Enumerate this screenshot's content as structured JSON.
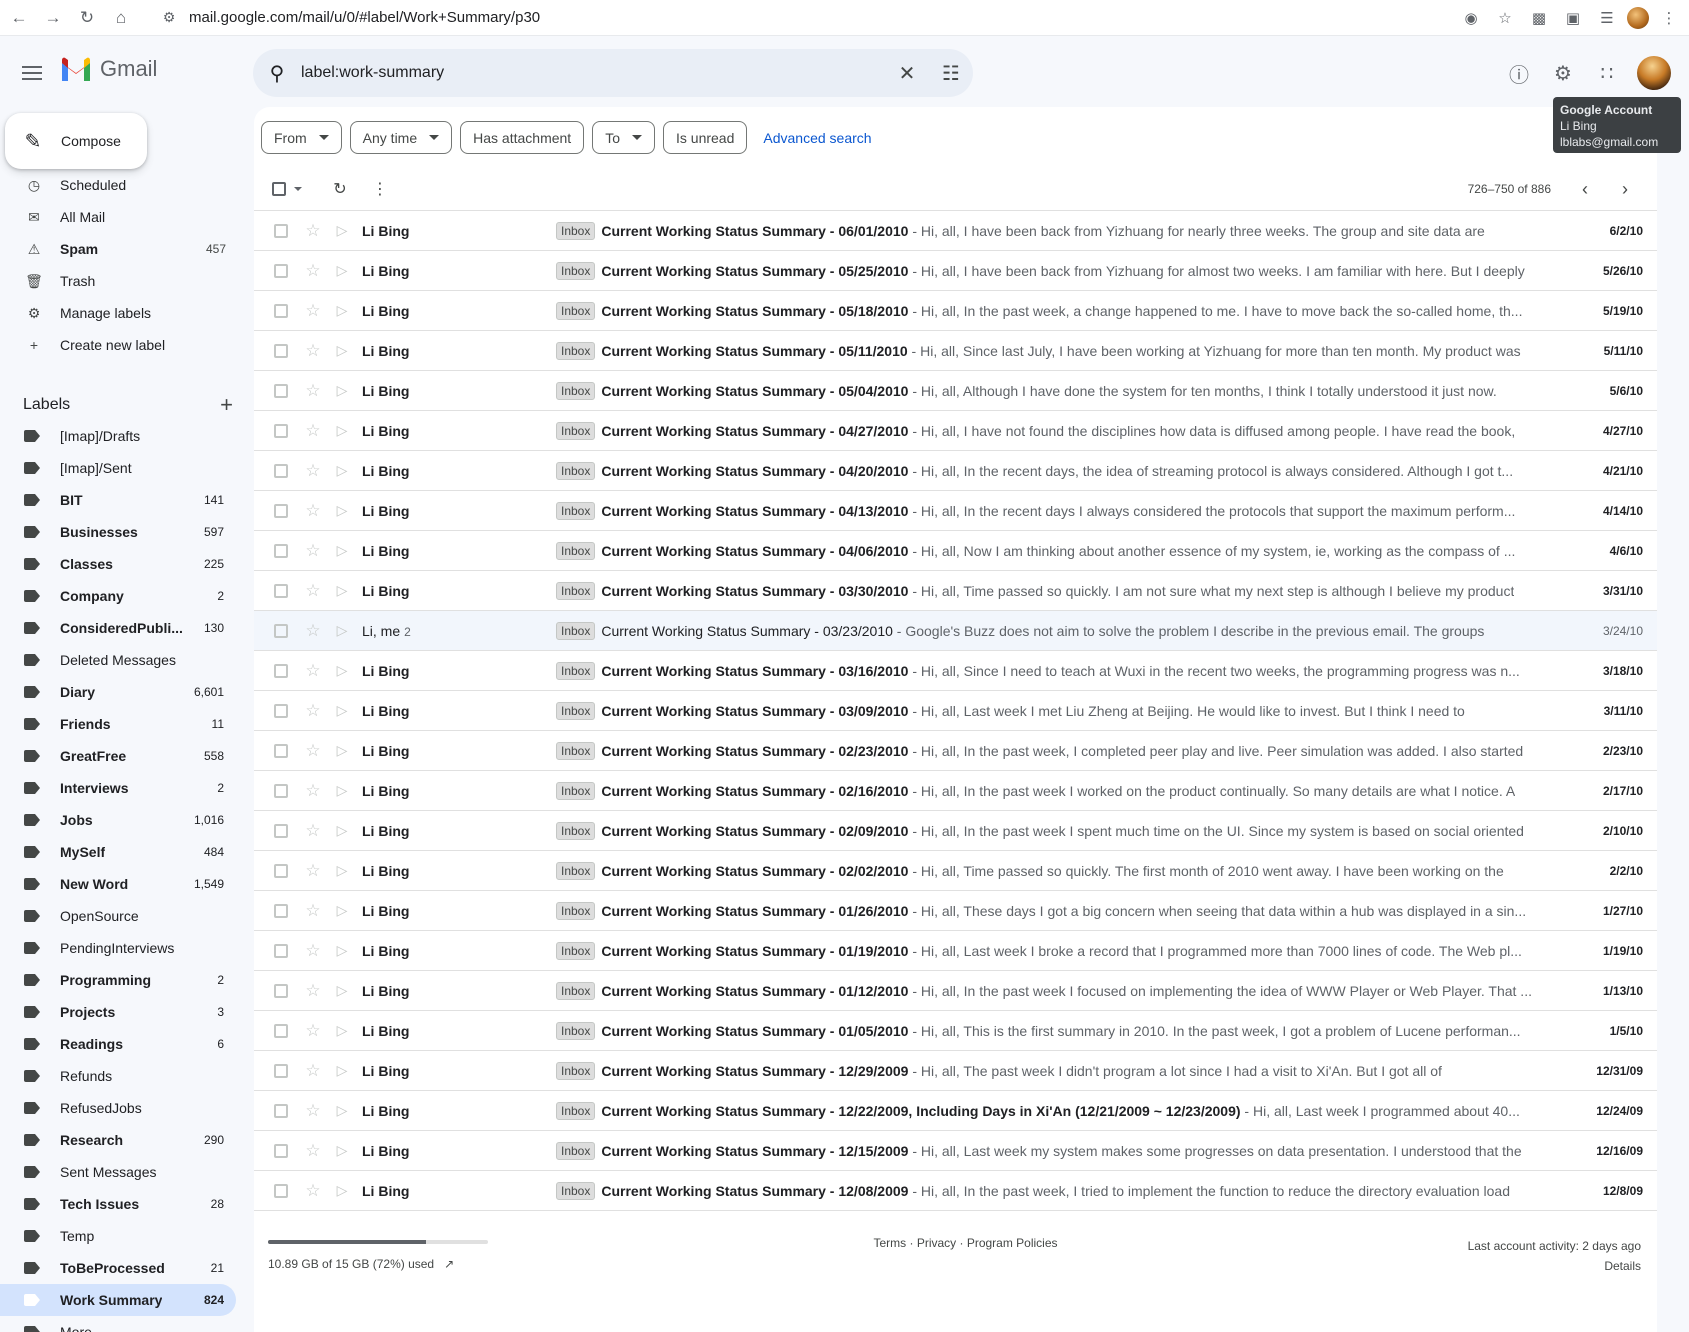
{
  "browser": {
    "url": "mail.google.com/mail/u/0/#label/Work+Summary/p30"
  },
  "header": {
    "app_name": "Gmail",
    "search_value": "label:work-summary"
  },
  "tooltip": {
    "title": "Google Account",
    "name": "Li Bing",
    "email": "lblabs@gmail.com"
  },
  "sidebar": {
    "compose_label": "Compose",
    "nav": [
      {
        "label": "Scheduled",
        "count": "",
        "icon": "scheduled-icon",
        "bold": false
      },
      {
        "label": "All Mail",
        "count": "",
        "icon": "all-mail-icon",
        "bold": false
      },
      {
        "label": "Spam",
        "count": "457",
        "icon": "spam-icon",
        "bold": true
      },
      {
        "label": "Trash",
        "count": "",
        "icon": "trash-icon",
        "bold": false
      },
      {
        "label": "Manage labels",
        "count": "",
        "icon": "gear-icon",
        "bold": false
      },
      {
        "label": "Create new label",
        "count": "",
        "icon": "plus-icon",
        "bold": false
      }
    ],
    "labels_heading": "Labels",
    "labels": [
      {
        "label": "[Imap]/Drafts",
        "count": "",
        "bold": false
      },
      {
        "label": "[Imap]/Sent",
        "count": "",
        "bold": false
      },
      {
        "label": "BIT",
        "count": "141",
        "bold": true
      },
      {
        "label": "Businesses",
        "count": "597",
        "bold": true
      },
      {
        "label": "Classes",
        "count": "225",
        "bold": true
      },
      {
        "label": "Company",
        "count": "2",
        "bold": true
      },
      {
        "label": "ConsideredPubli...",
        "count": "130",
        "bold": true
      },
      {
        "label": "Deleted Messages",
        "count": "",
        "bold": false
      },
      {
        "label": "Diary",
        "count": "6,601",
        "bold": true
      },
      {
        "label": "Friends",
        "count": "11",
        "bold": true
      },
      {
        "label": "GreatFree",
        "count": "558",
        "bold": true
      },
      {
        "label": "Interviews",
        "count": "2",
        "bold": true
      },
      {
        "label": "Jobs",
        "count": "1,016",
        "bold": true
      },
      {
        "label": "MySelf",
        "count": "484",
        "bold": true
      },
      {
        "label": "New Word",
        "count": "1,549",
        "bold": true
      },
      {
        "label": "OpenSource",
        "count": "",
        "bold": false
      },
      {
        "label": "PendingInterviews",
        "count": "",
        "bold": false
      },
      {
        "label": "Programming",
        "count": "2",
        "bold": true
      },
      {
        "label": "Projects",
        "count": "3",
        "bold": true
      },
      {
        "label": "Readings",
        "count": "6",
        "bold": true
      },
      {
        "label": "Refunds",
        "count": "",
        "bold": false
      },
      {
        "label": "RefusedJobs",
        "count": "",
        "bold": false
      },
      {
        "label": "Research",
        "count": "290",
        "bold": true
      },
      {
        "label": "Sent Messages",
        "count": "",
        "bold": false
      },
      {
        "label": "Tech Issues",
        "count": "28",
        "bold": true
      },
      {
        "label": "Temp",
        "count": "",
        "bold": false
      },
      {
        "label": "ToBeProcessed",
        "count": "21",
        "bold": true
      },
      {
        "label": "Work Summary",
        "count": "824",
        "bold": true,
        "active": true
      },
      {
        "label": "More",
        "count": "",
        "bold": false
      }
    ]
  },
  "filters": {
    "chips": [
      {
        "label": "From",
        "dropdown": true
      },
      {
        "label": "Any time",
        "dropdown": true
      },
      {
        "label": "Has attachment",
        "dropdown": false
      },
      {
        "label": "To",
        "dropdown": true
      },
      {
        "label": "Is unread",
        "dropdown": false
      }
    ],
    "advanced_search": "Advanced search"
  },
  "pager": {
    "text": "726–750 of 886"
  },
  "emails": [
    {
      "sender": "Li Bing",
      "count": "",
      "badge": "Inbox",
      "subject": "Current Working Status Summary - 06/01/2010",
      "snippet": " - Hi, all, I have been back from Yizhuang for nearly three weeks. The group and site data are",
      "date": "6/2/10",
      "read": false
    },
    {
      "sender": "Li Bing",
      "count": "",
      "badge": "Inbox",
      "subject": "Current Working Status Summary - 05/25/2010",
      "snippet": " - Hi, all, I have been back from Yizhuang for almost two weeks. I am familiar with here. But I deeply",
      "date": "5/26/10",
      "read": false
    },
    {
      "sender": "Li Bing",
      "count": "",
      "badge": "Inbox",
      "subject": "Current Working Status Summary - 05/18/2010",
      "snippet": " - Hi, all, In the past week, a change happened to me. I have to move back the so-called home, th...",
      "date": "5/19/10",
      "read": false
    },
    {
      "sender": "Li Bing",
      "count": "",
      "badge": "Inbox",
      "subject": "Current Working Status Summary - 05/11/2010",
      "snippet": " - Hi, all, Since last July, I have been working at Yizhuang for more than ten month. My product was",
      "date": "5/11/10",
      "read": false
    },
    {
      "sender": "Li Bing",
      "count": "",
      "badge": "Inbox",
      "subject": "Current Working Status Summary - 05/04/2010",
      "snippet": " - Hi, all, Although I have done the system for ten months, I think I totally understood it just now.",
      "date": "5/6/10",
      "read": false
    },
    {
      "sender": "Li Bing",
      "count": "",
      "badge": "Inbox",
      "subject": "Current Working Status Summary - 04/27/2010",
      "snippet": " - Hi, all, I have not found the disciplines how data is diffused among people. I have read the book,",
      "date": "4/27/10",
      "read": false
    },
    {
      "sender": "Li Bing",
      "count": "",
      "badge": "Inbox",
      "subject": "Current Working Status Summary - 04/20/2010",
      "snippet": " - Hi, all, In the recent days, the idea of streaming protocol is always considered. Although I got t...",
      "date": "4/21/10",
      "read": false
    },
    {
      "sender": "Li Bing",
      "count": "",
      "badge": "Inbox",
      "subject": "Current Working Status Summary - 04/13/2010",
      "snippet": " - Hi, all, In the recent days I always considered the protocols that support the maximum perform...",
      "date": "4/14/10",
      "read": false
    },
    {
      "sender": "Li Bing",
      "count": "",
      "badge": "Inbox",
      "subject": "Current Working Status Summary - 04/06/2010",
      "snippet": " - Hi, all, Now I am thinking about another essence of my system, ie, working as the compass of ...",
      "date": "4/6/10",
      "read": false
    },
    {
      "sender": "Li Bing",
      "count": "",
      "badge": "Inbox",
      "subject": "Current Working Status Summary - 03/30/2010",
      "snippet": " - Hi, all, Time passed so quickly. I am not sure what my next step is although I believe my product",
      "date": "3/31/10",
      "read": false
    },
    {
      "sender": "Li, me",
      "count": "2",
      "badge": "Inbox",
      "subject": "Current Working Status Summary - 03/23/2010",
      "snippet": " - Google's Buzz does not aim to solve the problem I describe in the previous email. The groups",
      "date": "3/24/10",
      "read": true
    },
    {
      "sender": "Li Bing",
      "count": "",
      "badge": "Inbox",
      "subject": "Current Working Status Summary - 03/16/2010",
      "snippet": " - Hi, all, Since I need to teach at Wuxi in the recent two weeks, the programming progress was n...",
      "date": "3/18/10",
      "read": false
    },
    {
      "sender": "Li Bing",
      "count": "",
      "badge": "Inbox",
      "subject": "Current Working Status Summary - 03/09/2010",
      "snippet": " - Hi, all, Last week I met Liu Zheng at Beijing. He would like to invest. But I think I need to",
      "date": "3/11/10",
      "read": false
    },
    {
      "sender": "Li Bing",
      "count": "",
      "badge": "Inbox",
      "subject": "Current Working Status Summary - 02/23/2010",
      "snippet": " - Hi, all, In the past week, I completed peer play and live. Peer simulation was added. I also started",
      "date": "2/23/10",
      "read": false
    },
    {
      "sender": "Li Bing",
      "count": "",
      "badge": "Inbox",
      "subject": "Current Working Status Summary - 02/16/2010",
      "snippet": " - Hi, all, In the past week I worked on the product continually. So many details are what I notice. A",
      "date": "2/17/10",
      "read": false
    },
    {
      "sender": "Li Bing",
      "count": "",
      "badge": "Inbox",
      "subject": "Current Working Status Summary - 02/09/2010",
      "snippet": " - Hi, all, In the past week I spent much time on the UI. Since my system is based on social oriented",
      "date": "2/10/10",
      "read": false
    },
    {
      "sender": "Li Bing",
      "count": "",
      "badge": "Inbox",
      "subject": "Current Working Status Summary - 02/02/2010",
      "snippet": " - Hi, all, Time passed so quickly. The first month of 2010 went away. I have been working on the",
      "date": "2/2/10",
      "read": false
    },
    {
      "sender": "Li Bing",
      "count": "",
      "badge": "Inbox",
      "subject": "Current Working Status Summary - 01/26/2010",
      "snippet": " - Hi, all, These days I got a big concern when seeing that data within a hub was displayed in a sin...",
      "date": "1/27/10",
      "read": false
    },
    {
      "sender": "Li Bing",
      "count": "",
      "badge": "Inbox",
      "subject": "Current Working Status Summary - 01/19/2010",
      "snippet": " - Hi, all, Last week I broke a record that I programmed more than 7000 lines of code. The Web pl...",
      "date": "1/19/10",
      "read": false
    },
    {
      "sender": "Li Bing",
      "count": "",
      "badge": "Inbox",
      "subject": "Current Working Status Summary - 01/12/2010",
      "snippet": " - Hi, all, In the past week I focused on implementing the idea of WWW Player or Web Player. That ...",
      "date": "1/13/10",
      "read": false
    },
    {
      "sender": "Li Bing",
      "count": "",
      "badge": "Inbox",
      "subject": "Current Working Status Summary - 01/05/2010",
      "snippet": " - Hi, all, This is the first summary in 2010. In the past week, I got a problem of Lucene performan...",
      "date": "1/5/10",
      "read": false
    },
    {
      "sender": "Li Bing",
      "count": "",
      "badge": "Inbox",
      "subject": "Current Working Status Summary - 12/29/2009",
      "snippet": " - Hi, all, The past week I didn't program a lot since I had a visit to Xi'An. But I got all of",
      "date": "12/31/09",
      "read": false
    },
    {
      "sender": "Li Bing",
      "count": "",
      "badge": "Inbox",
      "subject": "Current Working Status Summary - 12/22/2009, Including Days in Xi'An (12/21/2009 ~ 12/23/2009)",
      "snippet": " - Hi, all, Last week I programmed about 40...",
      "date": "12/24/09",
      "read": false
    },
    {
      "sender": "Li Bing",
      "count": "",
      "badge": "Inbox",
      "subject": "Current Working Status Summary - 12/15/2009",
      "snippet": " - Hi, all, Last week my system makes some progresses on data presentation. I understood that the",
      "date": "12/16/09",
      "read": false
    },
    {
      "sender": "Li Bing",
      "count": "",
      "badge": "Inbox",
      "subject": "Current Working Status Summary - 12/08/2009",
      "snippet": " - Hi, all, In the past week, I tried to implement the function to reduce the directory evaluation load",
      "date": "12/8/09",
      "read": false
    }
  ],
  "footer": {
    "storage_text": "10.89 GB of 15 GB (72%) used",
    "storage_fraction": 0.72,
    "links": "Terms · Privacy · Program Policies",
    "last_activity": "Last account activity: 2 days ago",
    "details": "Details"
  }
}
